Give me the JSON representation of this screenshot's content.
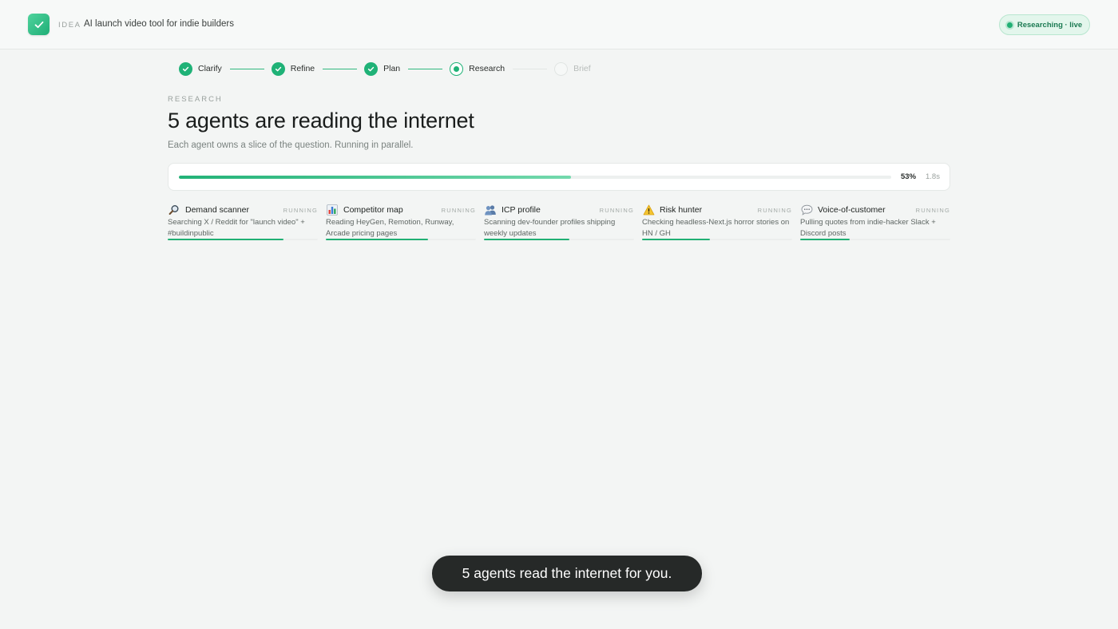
{
  "header": {
    "eyebrow": "IDEA",
    "idea_title": "AI launch video tool for indie builders",
    "status_badge": "Researching · live"
  },
  "stepper": {
    "steps": [
      {
        "label": "Clarify",
        "state": "done"
      },
      {
        "label": "Refine",
        "state": "done"
      },
      {
        "label": "Plan",
        "state": "done"
      },
      {
        "label": "Research",
        "state": "active"
      },
      {
        "label": "Brief",
        "state": "pending"
      }
    ]
  },
  "section": {
    "eyebrow": "RESEARCH",
    "headline": "5 agents are reading the internet",
    "subtext": "Each agent owns a slice of the question. Running in parallel."
  },
  "progress": {
    "percent_label": "53%",
    "fraction": 0.55,
    "elapsed": "1.8s"
  },
  "agents": [
    {
      "icon": "magnifier-icon",
      "name": "Demand scanner",
      "status": "RUNNING",
      "desc": "Searching X / Reddit for \"launch video\" + #buildinpublic",
      "progress": 0.77
    },
    {
      "icon": "bar-chart-icon",
      "name": "Competitor map",
      "status": "RUNNING",
      "desc": "Reading HeyGen, Remotion, Runway, Arcade pricing pages",
      "progress": 0.68
    },
    {
      "icon": "people-icon",
      "name": "ICP profile",
      "status": "RUNNING",
      "desc": "Scanning dev-founder profiles shipping weekly updates",
      "progress": 0.57
    },
    {
      "icon": "warning-icon",
      "name": "Risk hunter",
      "status": "RUNNING",
      "desc": "Checking headless-Next.js horror stories on HN / GH",
      "progress": 0.45
    },
    {
      "icon": "speech-bubble-icon",
      "name": "Voice-of-customer",
      "status": "RUNNING",
      "desc": "Pulling quotes from indie-hacker Slack + Discord posts",
      "progress": 0.33
    }
  ],
  "caption": "5 agents read the internet for you.",
  "colors": {
    "accent": "#21b074",
    "background": "#f3f5f4",
    "caption_bg": "#262928"
  }
}
